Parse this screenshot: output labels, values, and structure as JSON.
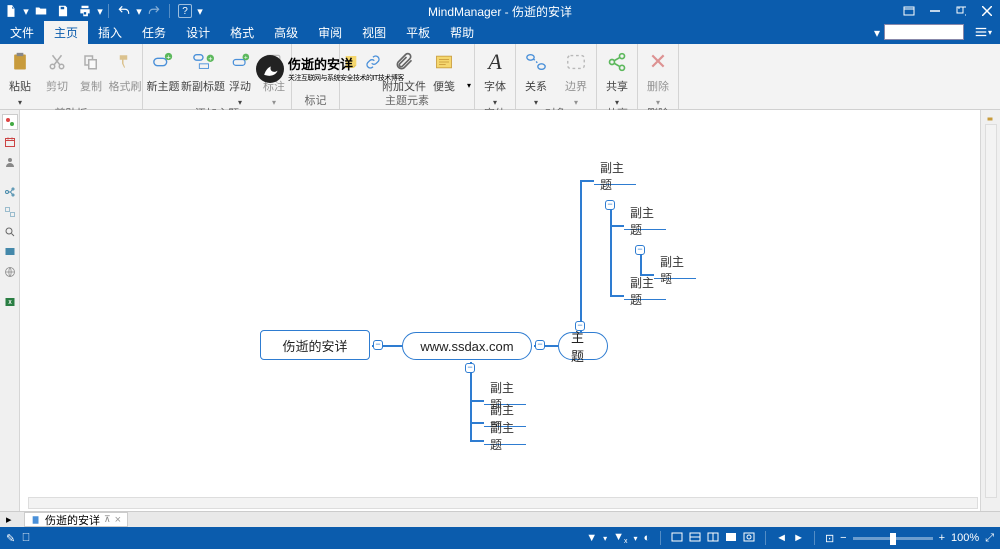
{
  "app": {
    "title": "MindManager - 伤逝的安详"
  },
  "qat": [
    "new",
    "open",
    "save",
    "print",
    "undo",
    "redo",
    "refresh",
    "help"
  ],
  "tabs": [
    "文件",
    "主页",
    "插入",
    "任务",
    "设计",
    "格式",
    "高级",
    "审阅",
    "视图",
    "平板",
    "帮助"
  ],
  "active_tab_index": 1,
  "ribbon": {
    "groups": [
      {
        "label": "剪贴板",
        "items": [
          {
            "l": "粘贴",
            "id": "paste",
            "big": 1
          },
          {
            "l": "剪切",
            "id": "cut",
            "dis": 1
          },
          {
            "l": "复制",
            "id": "copy",
            "dis": 1
          },
          {
            "l": "格式刷",
            "id": "fmtp",
            "dis": 1
          }
        ]
      },
      {
        "label": "添加主题",
        "items": [
          {
            "l": "新主题",
            "id": "newtopic",
            "big": 1
          },
          {
            "l": "新副标题",
            "id": "newsub",
            "big": 1
          },
          {
            "l": "浮动",
            "id": "float"
          },
          {
            "l": "标注",
            "id": "callout",
            "dis": 1
          }
        ]
      },
      {
        "label": "标记",
        "items": [
          {
            "l": "",
            "id": "mark-logo",
            "big": 1
          },
          {
            "l": "",
            "id": "mark-text",
            "big": 1
          }
        ]
      },
      {
        "label": "主题元素",
        "items": [
          {
            "l": "",
            "id": "note"
          },
          {
            "l": "",
            "id": "link"
          },
          {
            "l": "附加文件",
            "id": "attach",
            "big": 1
          },
          {
            "l": "便笺",
            "id": "notecard",
            "big": 1
          }
        ]
      },
      {
        "label": "字体",
        "items": [
          {
            "l": "字体",
            "id": "font",
            "big": 1
          }
        ]
      },
      {
        "label": "对象",
        "items": [
          {
            "l": "关系",
            "id": "rel",
            "big": 1
          },
          {
            "l": "边界",
            "id": "bound",
            "big": 1,
            "dis": 1
          }
        ]
      },
      {
        "label": "共享",
        "items": [
          {
            "l": "共享",
            "id": "share",
            "big": 1
          }
        ]
      },
      {
        "label": "删除",
        "items": [
          {
            "l": "删除",
            "id": "delete",
            "big": 1,
            "dis": 1
          }
        ]
      }
    ]
  },
  "watermark": {
    "name": "伤逝的安详",
    "sub": "关注互联网与系统安全技术的IT技术博客"
  },
  "map": {
    "root": {
      "text": "伤逝的安详"
    },
    "child": {
      "text": "www.ssdax.com"
    },
    "topic": {
      "text": "主题"
    },
    "subs": [
      "副主题",
      "副主题",
      "副主题",
      "副主题",
      "副主题",
      "副主题",
      "副主题"
    ]
  },
  "doctab": {
    "name": "伤逝的安详"
  },
  "status": {
    "zoom": "100%"
  }
}
